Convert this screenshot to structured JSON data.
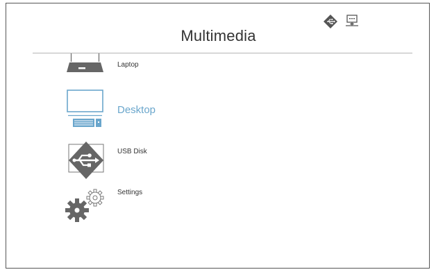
{
  "header": {
    "title": "Multimedia",
    "status_icons": [
      "usb-connection-icon",
      "network-computer-icon"
    ]
  },
  "menu": {
    "items": [
      {
        "label": "Laptop",
        "icon": "laptop-icon",
        "selected": false
      },
      {
        "label": "Desktop",
        "icon": "desktop-icon",
        "selected": true
      },
      {
        "label": "USB Disk",
        "icon": "usb-disk-icon",
        "selected": false
      },
      {
        "label": "Settings",
        "icon": "settings-gears-icon",
        "selected": false
      }
    ]
  },
  "colors": {
    "selected": "#6aa6cc",
    "icon_gray": "#666666",
    "text": "#333333"
  }
}
